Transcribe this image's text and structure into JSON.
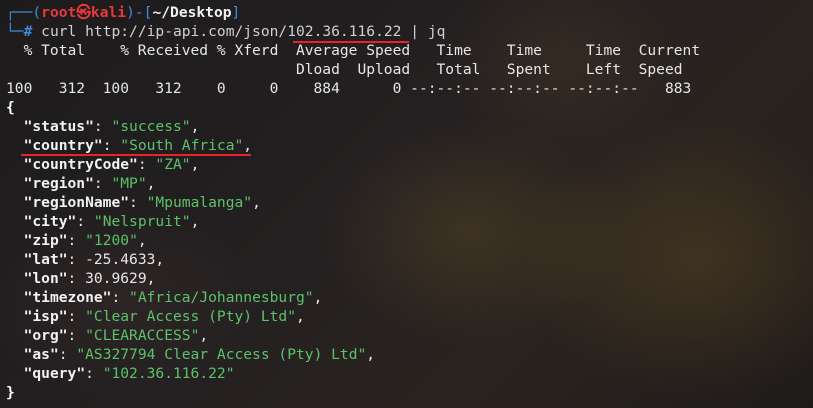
{
  "prompt": {
    "corner_top": "┌──",
    "open": "(",
    "user": "root",
    "at_symbol": "㉿",
    "host": "kali",
    "close": ")",
    "dash": "-",
    "dir_open": "[",
    "cwd": "~/Desktop",
    "dir_close": "]",
    "corner_bottom": "└─",
    "hash": "#"
  },
  "command": {
    "curl": "curl",
    "url_prefix": "http://ip-api.com/json/",
    "ip": "102.36.116.22",
    "pipe": "|",
    "jq": "jq"
  },
  "progress": {
    "header1": "  % Total    % Received % Xferd  Average Speed   Time    Time     Time  Current",
    "header2": "                                 Dload  Upload   Total   Spent    Left  Speed",
    "row": "100   312  100   312    0     0    884      0 --:--:-- --:--:-- --:--:--   883"
  },
  "json": {
    "open": "{",
    "close": "}",
    "entries": [
      {
        "key": "status",
        "value": "success",
        "type": "string"
      },
      {
        "key": "country",
        "value": "South Africa",
        "type": "string"
      },
      {
        "key": "countryCode",
        "value": "ZA",
        "type": "string"
      },
      {
        "key": "region",
        "value": "MP",
        "type": "string"
      },
      {
        "key": "regionName",
        "value": "Mpumalanga",
        "type": "string"
      },
      {
        "key": "city",
        "value": "Nelspruit",
        "type": "string"
      },
      {
        "key": "zip",
        "value": "1200",
        "type": "string"
      },
      {
        "key": "lat",
        "value": "-25.4633",
        "type": "number"
      },
      {
        "key": "lon",
        "value": "30.9629",
        "type": "number"
      },
      {
        "key": "timezone",
        "value": "Africa/Johannesburg",
        "type": "string"
      },
      {
        "key": "isp",
        "value": "Clear Access (Pty) Ltd",
        "type": "string"
      },
      {
        "key": "org",
        "value": "CLEARACCESS",
        "type": "string"
      },
      {
        "key": "as",
        "value": "AS327794 Clear Access (Pty) Ltd",
        "type": "string"
      },
      {
        "key": "query",
        "value": "102.36.116.22",
        "type": "string"
      }
    ]
  },
  "colors": {
    "prompt_blue": "#3f8bd8",
    "user_red": "#e63a3a",
    "string_green": "#5cc26a",
    "annotation_underline": "#e8242a",
    "background": "#1c1a1a"
  }
}
